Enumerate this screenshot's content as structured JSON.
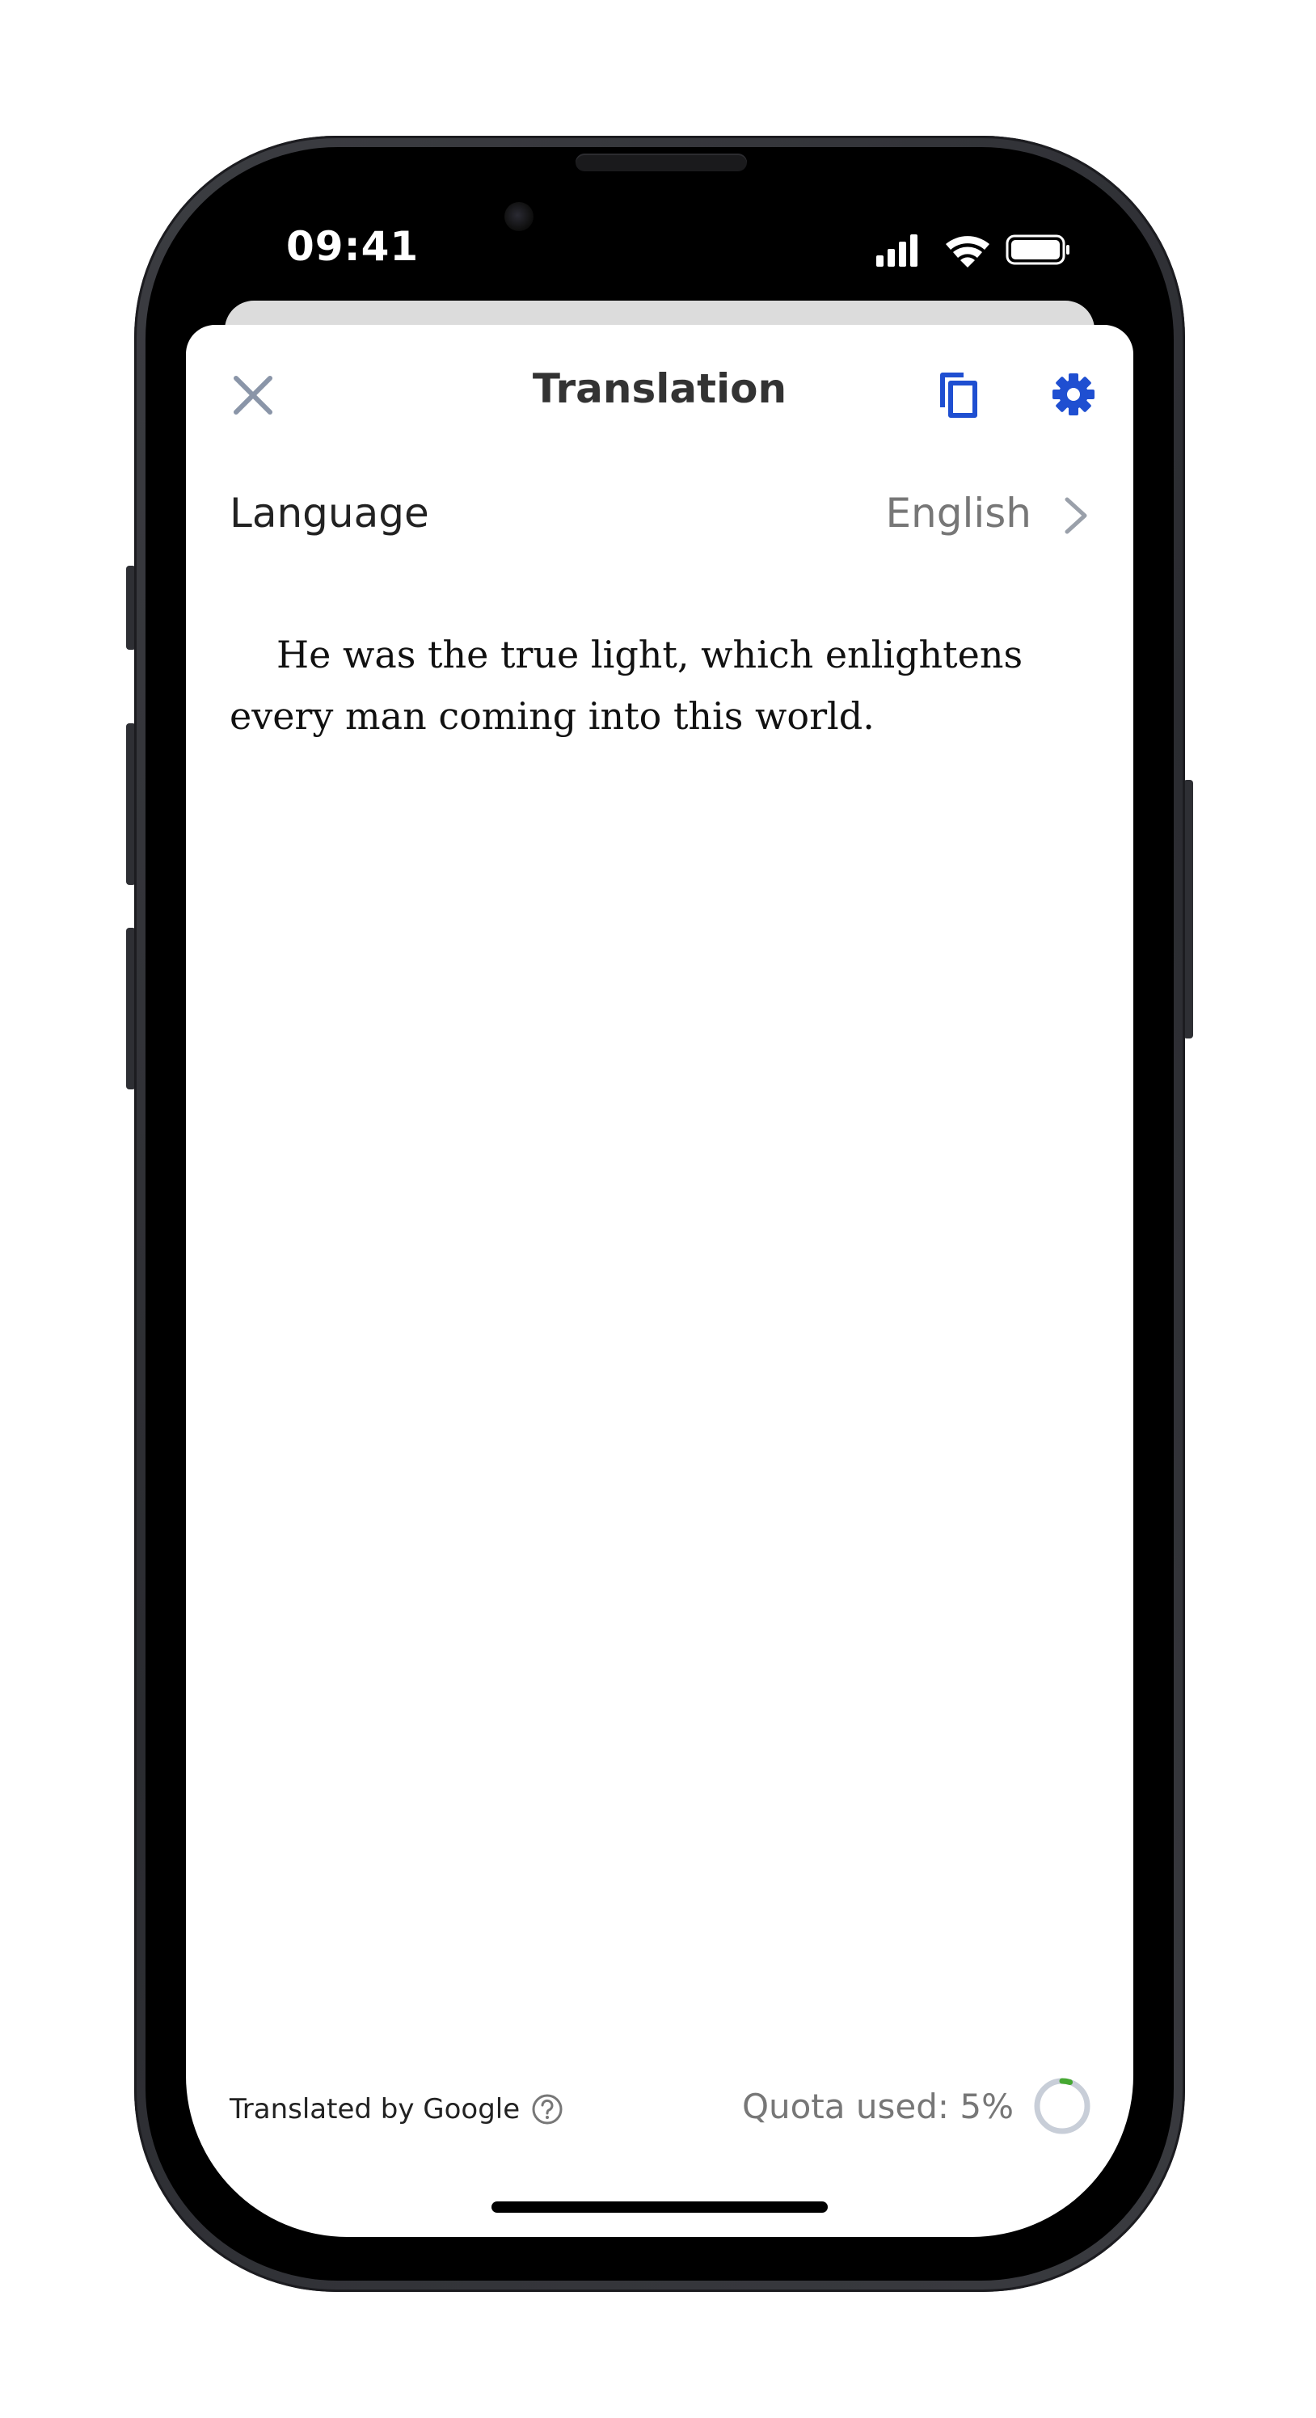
{
  "status_bar": {
    "time": "09:41"
  },
  "sheet": {
    "title": "Translation",
    "close_icon": "close-icon",
    "copy_icon": "copy-icon",
    "settings_icon": "gear-icon"
  },
  "language": {
    "label": "Language",
    "value": "English",
    "chevron_icon": "chevron-right-icon"
  },
  "translation": {
    "text": "He was the true light, which enlightens every man coming into this world."
  },
  "footer": {
    "credit": "Translated by Google",
    "help_icon": "question-circle-icon",
    "quota_label": "Quota used: 5%",
    "quota_fraction": 0.05
  },
  "colors": {
    "accent": "#1f4fd1",
    "close_gray": "#8a95a8",
    "ring_track": "#c8ced8",
    "ring_progress": "#46a832"
  }
}
